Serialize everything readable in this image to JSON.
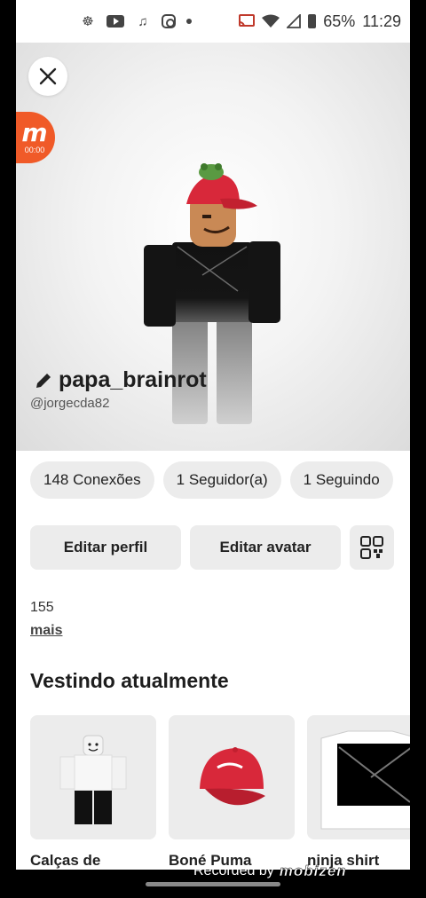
{
  "status_bar": {
    "battery": "65%",
    "time": "11:29"
  },
  "overlay": {
    "recorder_time": "00:00",
    "recorded_by": "Recorded by",
    "recorder_brand": "mobizen"
  },
  "profile": {
    "display_name": "papa_brainrot",
    "username": "@jorgecda82"
  },
  "stats": {
    "connections": "148 Conexões",
    "followers": "1 Seguidor(a)",
    "following": "1 Seguindo"
  },
  "actions": {
    "edit_profile": "Editar perfil",
    "edit_avatar": "Editar avatar"
  },
  "about": {
    "text": "155",
    "more": "mais"
  },
  "wearing": {
    "title": "Vestindo atualmente",
    "items": [
      {
        "label": "Calças de"
      },
      {
        "label": "Boné Puma"
      },
      {
        "label": "ninja shirt"
      }
    ]
  },
  "colors": {
    "accent_recorder": "#f05a28",
    "cap_red": "#d8283a",
    "pill_bg": "#ececec"
  }
}
